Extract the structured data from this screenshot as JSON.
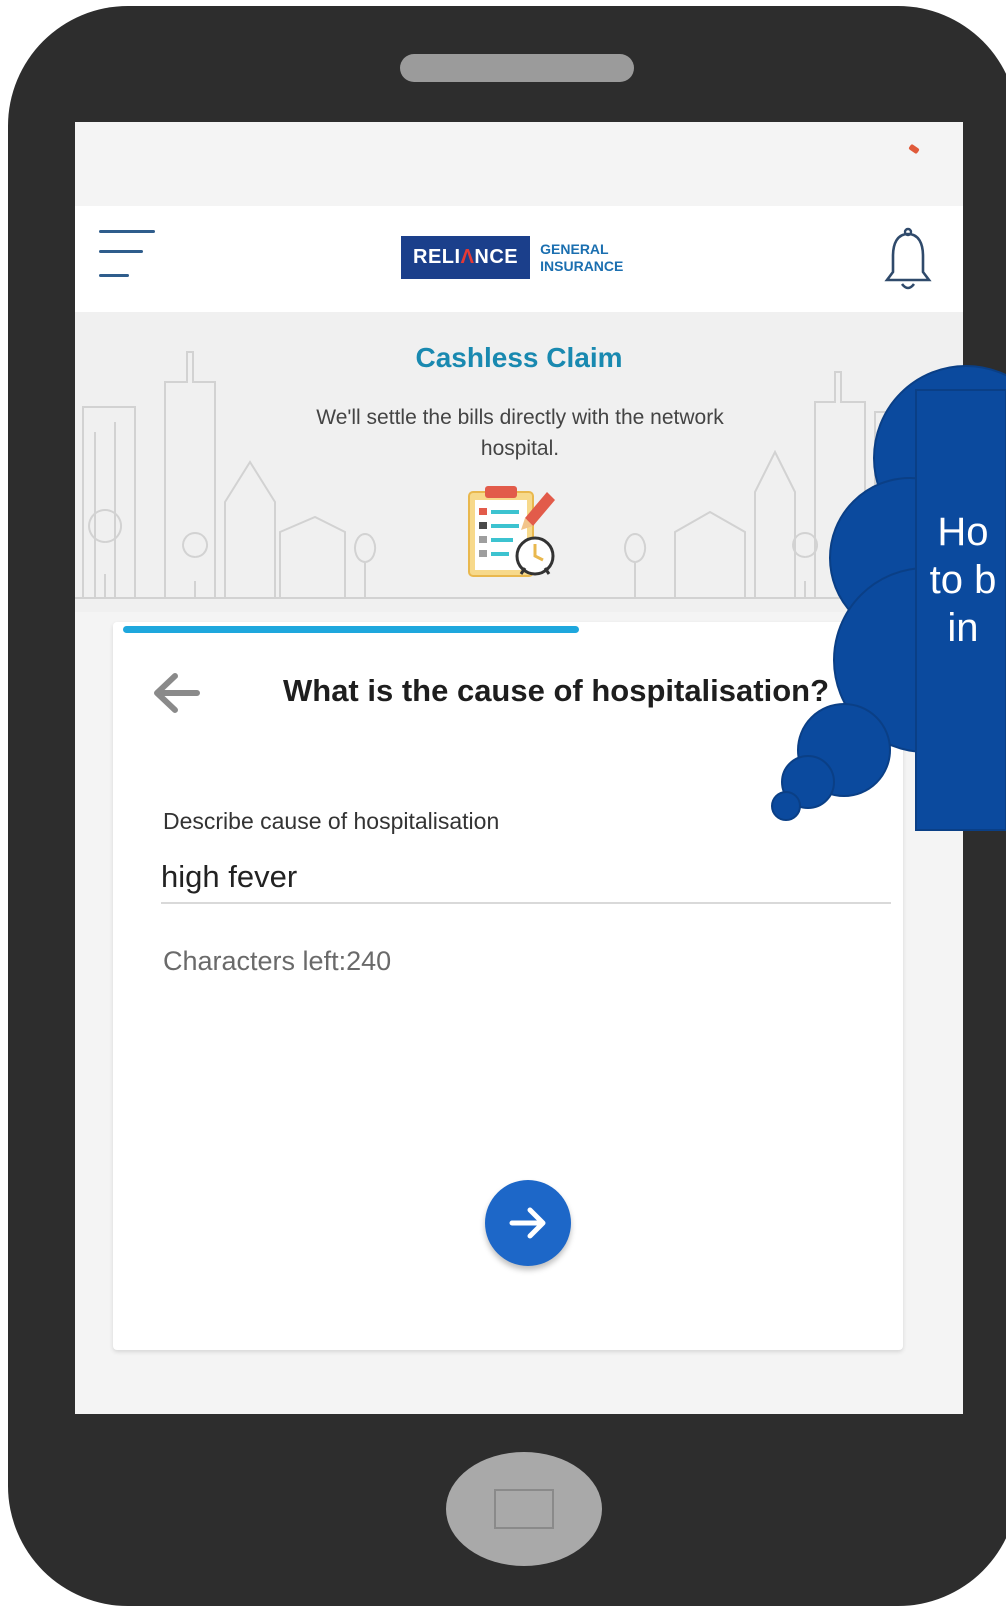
{
  "app": {
    "logo_word": "RELIANCE",
    "logo_sub_line1": "GENERAL",
    "logo_sub_line2": "INSURANCE"
  },
  "hero": {
    "title": "Cashless Claim",
    "subtitle": "We'll settle the bills directly with the network hospital."
  },
  "progress": {
    "fraction": 0.6
  },
  "form": {
    "question": "What is the cause of hospitalisation?",
    "field_label": "Describe cause of hospitalisation",
    "field_value": "high fever",
    "chars_left": "Characters left:240"
  },
  "callout": {
    "line1": "Ho",
    "line2": "to b",
    "line3": "in"
  },
  "colors": {
    "accent": "#1989b0",
    "progress": "#1ea7dd",
    "button": "#1d67c8",
    "logo_bg": "#1b3f8b",
    "callout": "#0b4a9e"
  },
  "icons": {
    "menu": "hamburger-icon",
    "notifications": "bell-icon",
    "back": "arrow-left-icon",
    "next": "arrow-right-icon",
    "illustration": "clipboard-clock-icon"
  }
}
